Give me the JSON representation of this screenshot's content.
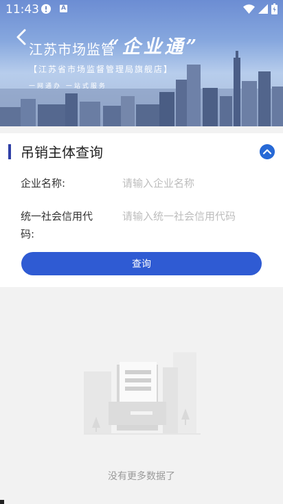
{
  "status_bar": {
    "time": "11:43",
    "icons": [
      "alert-circle-icon",
      "a-badge-icon",
      "wifi-icon",
      "signal-icon",
      "battery-icon"
    ]
  },
  "banner": {
    "back_icon": "chevron-left-icon",
    "title": "江苏市场监管",
    "slogan": "“企业通”",
    "store": "【江苏省市场监督管理局旗舰店】",
    "motto": "一网通办 一站式服务"
  },
  "query_section": {
    "title": "吊销主体查询",
    "collapse_icon": "chevron-up-circle-icon",
    "company_name": {
      "label": "企业名称:",
      "value": "",
      "placeholder": "请输入企业名称"
    },
    "credit_code": {
      "label_line1": "统一社会信用代",
      "label_line2": "码:",
      "value": "",
      "placeholder": "请输入统一社会信用代码"
    },
    "query_button": "查询"
  },
  "empty_state": {
    "icon": "empty-document-icon",
    "message": "没有更多数据了"
  },
  "colors": {
    "accent": "#2f5bd3",
    "section_bar": "#2f3fa6",
    "collapse_button": "#2769d6",
    "background": "#f2f2f2"
  }
}
